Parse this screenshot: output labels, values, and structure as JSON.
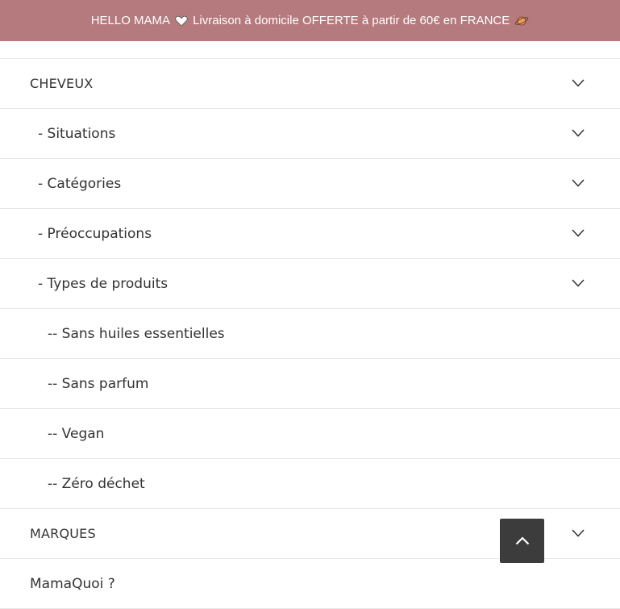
{
  "announcement": {
    "before_heart": "HELLO MAMA",
    "after_heart": "Livraison à domicile OFFERTE à partir de 60€ en FRANCE",
    "heart_icon": "heart-icon",
    "planet_icon": "planet-icon",
    "background": "#b47a7d"
  },
  "menu": {
    "items": [
      {
        "label": "CHEVEUX",
        "level": 0,
        "expandable": true
      },
      {
        "label": "- Situations",
        "level": 1,
        "expandable": true
      },
      {
        "label": "- Catégories",
        "level": 1,
        "expandable": true
      },
      {
        "label": "- Préoccupations",
        "level": 1,
        "expandable": true
      },
      {
        "label": "- Types de produits",
        "level": 1,
        "expandable": true
      },
      {
        "label": "-- Sans huiles essentielles",
        "level": 2,
        "expandable": false
      },
      {
        "label": "-- Sans parfum",
        "level": 2,
        "expandable": false
      },
      {
        "label": "-- Vegan",
        "level": 2,
        "expandable": false
      },
      {
        "label": "-- Zéro déchet",
        "level": 2,
        "expandable": false
      },
      {
        "label": "MARQUES",
        "level": 0,
        "expandable": true
      },
      {
        "label": "MamaQuoi ?",
        "level": 0,
        "expandable": false
      }
    ]
  },
  "scroll_top": {
    "icon": "chevron-up-icon"
  }
}
